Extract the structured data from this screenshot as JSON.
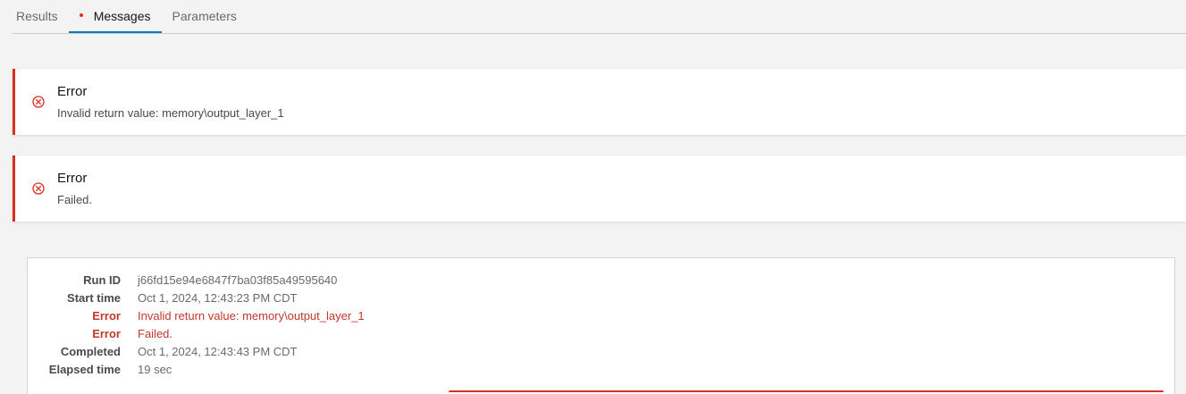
{
  "tabs": [
    {
      "label": "Results"
    },
    {
      "label": "Messages"
    },
    {
      "label": "Parameters"
    }
  ],
  "notices": [
    {
      "title": "Error",
      "message": "Invalid return value: memory\\output_layer_1",
      "icon": "error-circle-x-icon"
    },
    {
      "title": "Error",
      "message": "Failed.",
      "icon": "error-circle-x-icon"
    }
  ],
  "details": {
    "rows": [
      {
        "key": "Run ID",
        "value": "j66fd15e94e6847f7ba03f85a49595640"
      },
      {
        "key": "Start time",
        "value": "Oct 1, 2024, 12:43:23 PM CDT"
      },
      {
        "key": "Error",
        "value": "Invalid return value: memory\\output_layer_1"
      },
      {
        "key": "Error",
        "value": "Failed."
      },
      {
        "key": "Completed",
        "value": "Oct 1, 2024, 12:43:43 PM CDT"
      },
      {
        "key": "Elapsed time",
        "value": "19 sec"
      }
    ]
  },
  "colors": {
    "accent": "#007ac2",
    "error": "#d83020",
    "error_text": "#c0392b"
  }
}
